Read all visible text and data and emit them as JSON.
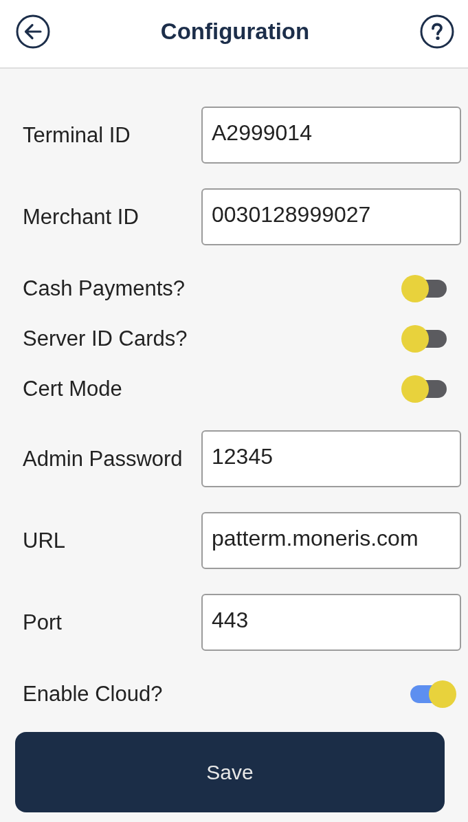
{
  "header": {
    "title": "Configuration"
  },
  "settings": [
    {
      "kind": "field",
      "label": "Terminal ID",
      "value": "A2999014"
    },
    {
      "kind": "field",
      "label": "Merchant ID",
      "value": "0030128999027"
    },
    {
      "kind": "toggle",
      "label": "Cash Payments?",
      "on": false
    },
    {
      "kind": "toggle",
      "label": "Server ID Cards?",
      "on": false
    },
    {
      "kind": "toggle",
      "label": "Cert Mode",
      "on": false
    },
    {
      "kind": "field",
      "label": "Admin Password",
      "value": "12345"
    },
    {
      "kind": "field",
      "label": "URL",
      "value": "patterm.moneris.com"
    },
    {
      "kind": "field",
      "label": "Port",
      "value": "443"
    },
    {
      "kind": "toggle",
      "label": "Enable Cloud?",
      "on": true
    }
  ],
  "save_button": {
    "label": "Save"
  }
}
